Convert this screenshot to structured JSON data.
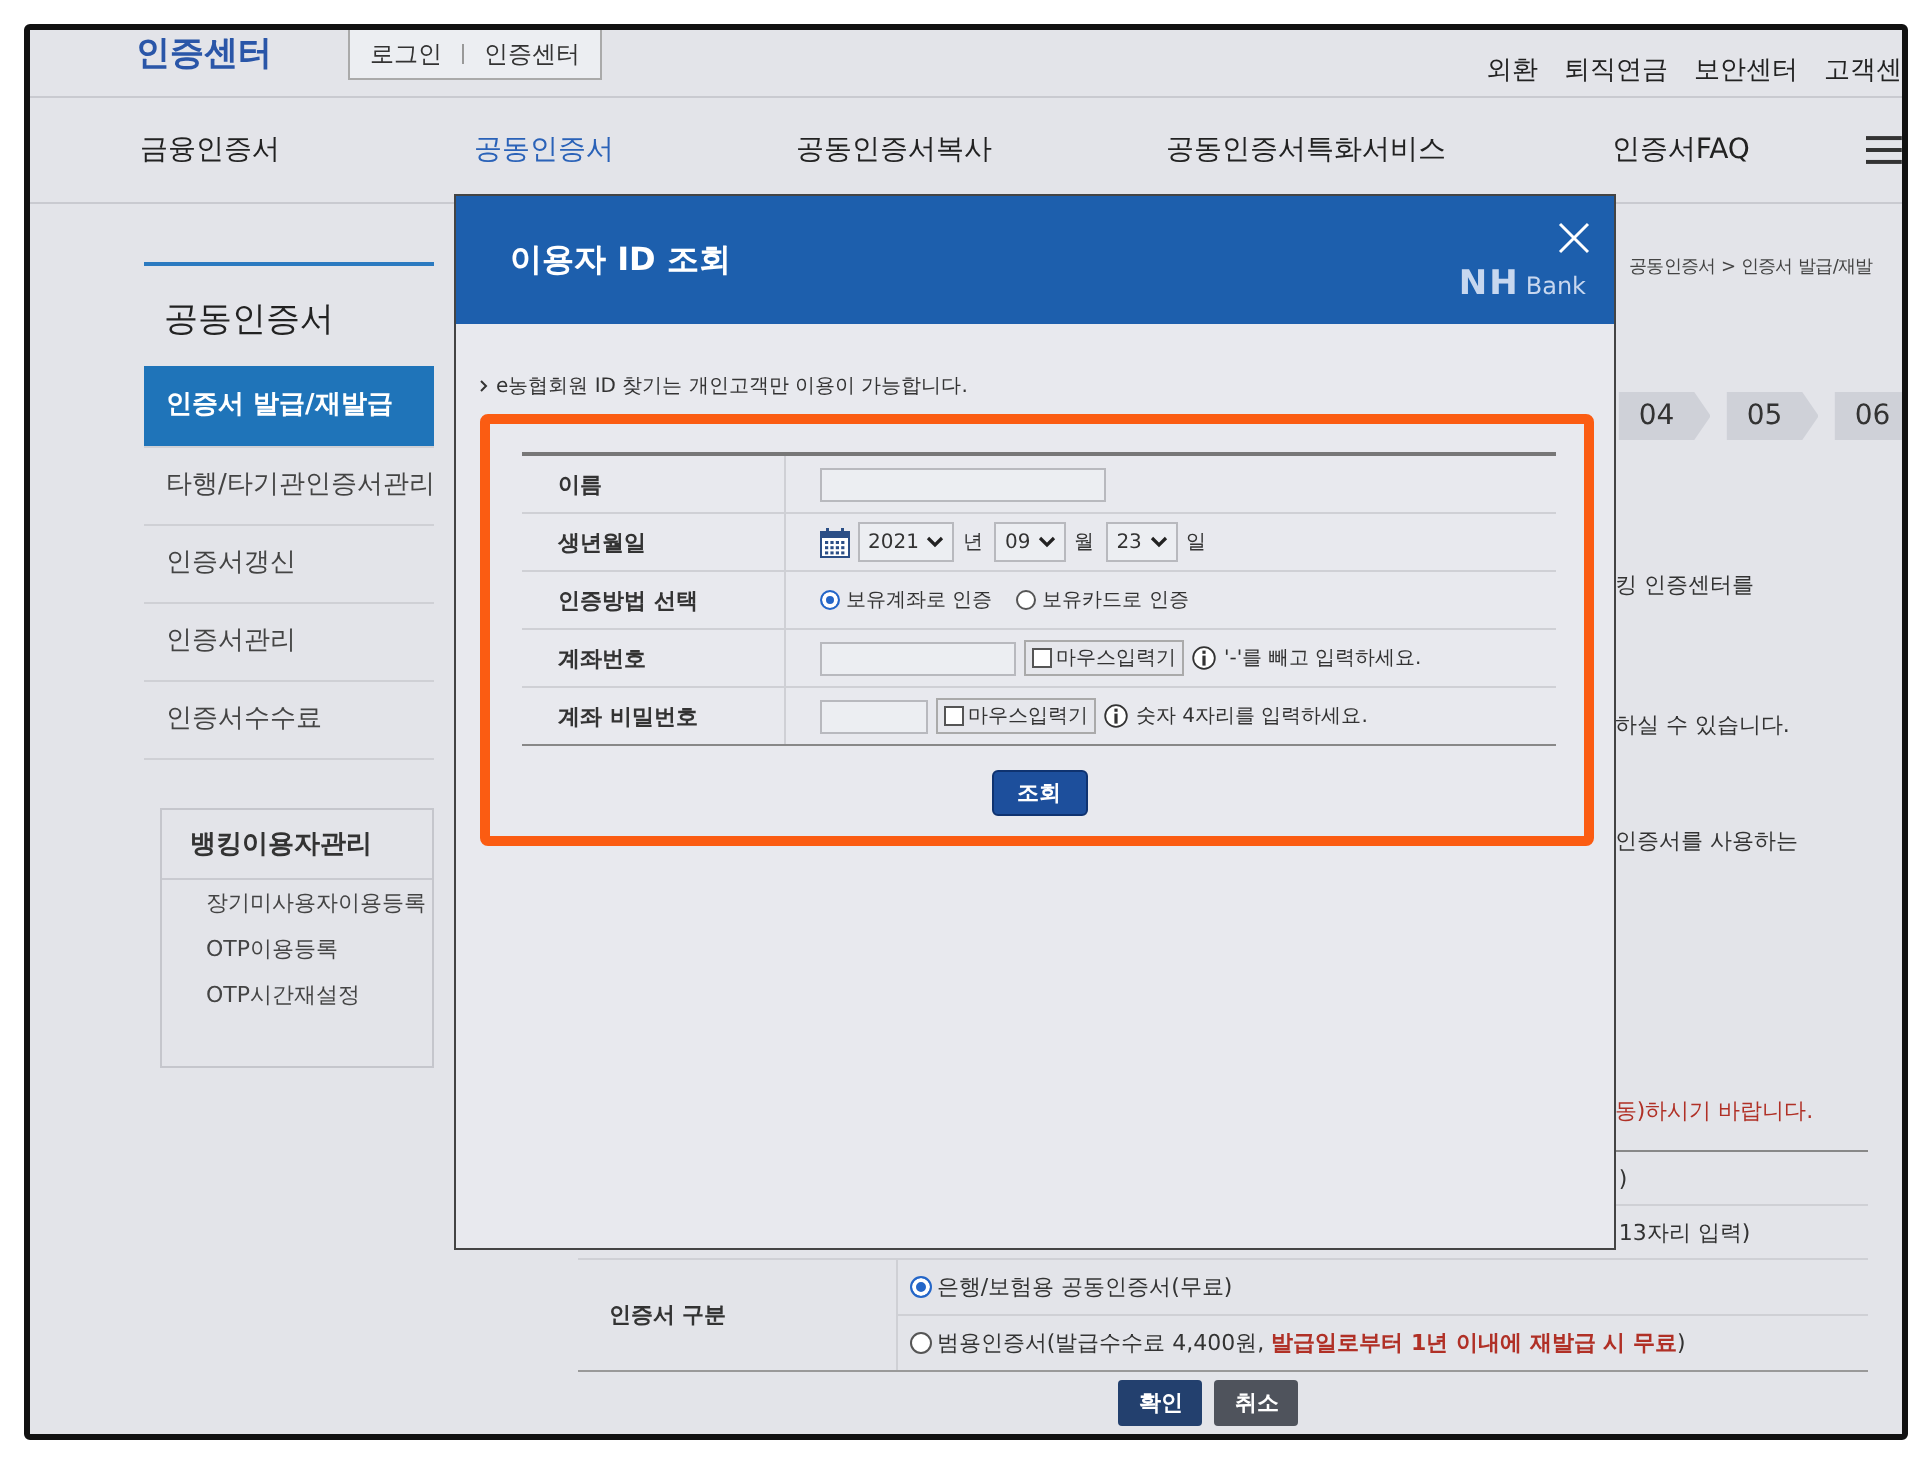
{
  "header": {
    "logo": "인증센터",
    "login_links": [
      "로그인",
      "인증센터"
    ],
    "utility_links": [
      "외환",
      "퇴직연금",
      "보안센터",
      "고객센"
    ]
  },
  "nav": {
    "items": [
      {
        "label": "금융인증서",
        "selected": false
      },
      {
        "label": "공동인증서",
        "selected": true
      },
      {
        "label": "공동인증서복사",
        "selected": false
      },
      {
        "label": "공동인증서특화서비스",
        "selected": false
      },
      {
        "label": "인증서FAQ",
        "selected": false
      }
    ]
  },
  "sidebar": {
    "title": "공동인증서",
    "items": [
      {
        "label": "인증서 발급/재발급",
        "selected": true
      },
      {
        "label": "타행/타기관인증서관리",
        "selected": false
      },
      {
        "label": "인증서갱신",
        "selected": false
      },
      {
        "label": "인증서관리",
        "selected": false
      },
      {
        "label": "인증서수수료",
        "selected": false
      }
    ],
    "banking_box": {
      "title": "뱅킹이용자관리",
      "links": [
        "장기미사용자이용등록",
        "OTP이용등록",
        "OTP시간재설정"
      ]
    }
  },
  "content": {
    "breadcrumb": "공동인증서 > 인증서 발급/재발",
    "steps": [
      "04",
      "05",
      "06"
    ],
    "text_fragments": [
      {
        "text": "킹 인증센터를",
        "kind": "normal"
      },
      {
        "text": "하실 수 있습니다.",
        "kind": "normal"
      },
      {
        "text": "인증서를 사용하는",
        "kind": "normal"
      },
      {
        "text": "동)하시기 바랍니다.",
        "kind": "warning"
      }
    ],
    "table_rows": [
      ")",
      "13자리 입력)"
    ],
    "cert_type": {
      "label": "인증서 구분",
      "options": [
        {
          "label": "은행/보험용 공동인증서(무료)",
          "selected": true
        },
        {
          "label": "범용인증서(발급수수료 4,400원, **발급일로부터 1년 이내에 재발급 시 무료**)",
          "selected": false
        }
      ]
    },
    "buttons": [
      {
        "label": "확인",
        "kind": "primary"
      },
      {
        "label": "취소",
        "kind": "secondary"
      }
    ]
  },
  "modal": {
    "title": "이용자 ID 조회",
    "brand": {
      "mark": "NH",
      "text": "Bank"
    },
    "notice": "e농협회원 ID 찾기는 개인고객만 이용이 가능합니다.",
    "highlighted": true,
    "fields": [
      {
        "kind": "text",
        "label": "이름"
      },
      {
        "kind": "date",
        "label": "생년월일",
        "parts": [
          {
            "value": "2021",
            "unit": "년"
          },
          {
            "value": "09",
            "unit": "월"
          },
          {
            "value": "23",
            "unit": "일"
          }
        ]
      },
      {
        "kind": "radio",
        "label": "인증방법 선택",
        "options": [
          {
            "label": "보유계좌로 인증",
            "selected": true
          },
          {
            "label": "보유카드로 인증",
            "selected": false
          }
        ]
      },
      {
        "kind": "account",
        "label": "계좌번호",
        "keypad": {
          "label": "마우스입력기",
          "checked": false
        },
        "hint": "'-'를 빼고 입력하세요."
      },
      {
        "kind": "pin",
        "label": "계좌 비밀번호",
        "keypad": {
          "label": "마우스입력기",
          "checked": false
        },
        "hint": "숫자 4자리를 입력하세요."
      }
    ],
    "submit": "조회"
  }
}
